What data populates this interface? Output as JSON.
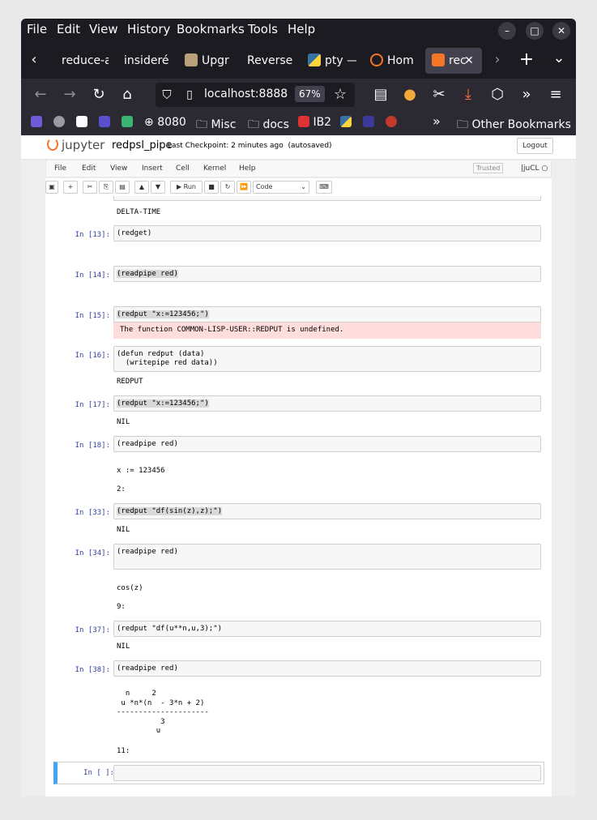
{
  "menubar": [
    "File",
    "Edit",
    "View",
    "History",
    "Bookmarks",
    "Tools",
    "Help"
  ],
  "window_buttons": {
    "minimize": "–",
    "maximize": "□",
    "close": "✕"
  },
  "tabs": [
    {
      "label": "reduce-a"
    },
    {
      "label": "insideré"
    },
    {
      "label": "Upgr"
    },
    {
      "label": "Reverse"
    },
    {
      "label": "pty —"
    },
    {
      "label": "Hom"
    },
    {
      "label": "rec",
      "active": true
    }
  ],
  "tab_controls": {
    "back": "‹",
    "forward": "›",
    "new": "+",
    "list": "⌄",
    "close": "✕"
  },
  "nav": {
    "url": "localhost:8888",
    "zoom": "67%"
  },
  "bookmarks": [
    {
      "label": "8080"
    },
    {
      "label": "Misc"
    },
    {
      "label": "docs"
    },
    {
      "label": "IB2"
    },
    {
      "label": "Other Bookmarks"
    }
  ],
  "jupyter": {
    "logo": "jupyter",
    "notebook_name": "redpsl_pipe",
    "checkpoint": "Last Checkpoint: 2 minutes ago",
    "autosaved": "(autosaved)",
    "logout": "Logout",
    "menu": [
      "File",
      "Edit",
      "View",
      "Insert",
      "Cell",
      "Kernel",
      "Help"
    ],
    "trusted": "Trusted",
    "kernel": "juCL",
    "toolbar": {
      "run": "▶ Run",
      "celltype": "Code"
    }
  },
  "cells": {
    "top_output": "DELTA-TIME",
    "c13": {
      "prompt": "In [13]:",
      "code": "(redget)"
    },
    "c14": {
      "prompt": "In [14]:",
      "code": "(readpipe red)"
    },
    "c15": {
      "prompt": "In [15]:",
      "code": "(redput \"x:=123456;\")",
      "error": "The function COMMON-LISP-USER::REDPUT is undefined."
    },
    "c16": {
      "prompt": "In [16]:",
      "code": "(defun redput (data)\n  (writepipe red data))",
      "out": "REDPUT"
    },
    "c17": {
      "prompt": "In [17]:",
      "code": "(redput \"x:=123456;\")",
      "out": "NIL"
    },
    "c18": {
      "prompt": "In [18]:",
      "code": "(readpipe red)",
      "out1": "x := 123456",
      "out2": "2:"
    },
    "c33": {
      "prompt": "In [33]:",
      "code": "(redput \"df(sin(z),z);\")",
      "out": "NIL"
    },
    "c34": {
      "prompt": "In [34]:",
      "code": "(readpipe red)",
      "out1": "cos(z)",
      "out2": "9:"
    },
    "c37": {
      "prompt": "In [37]:",
      "code": "(redput \"df(u**n,u,3);\")",
      "out": "NIL"
    },
    "c38": {
      "prompt": "In [38]:",
      "code": "(readpipe red)",
      "out1": "  n     2\n u *n*(n  - 3*n + 2)\n---------------------\n          3\n         u",
      "out2": "11:"
    },
    "last": {
      "prompt": "In [ ]:",
      "code": ""
    }
  }
}
